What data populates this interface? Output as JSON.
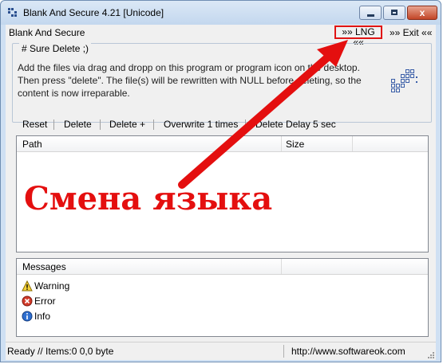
{
  "window": {
    "title": "Blank And Secure 4.21 [Unicode]",
    "close_glyph": "x"
  },
  "menu": {
    "app_label": "Blank And Secure",
    "lng_label": "»» LNG ««",
    "exit_label": "»» Exit ««"
  },
  "info": {
    "title": "# Sure Delete ;)",
    "text": "Add the files via drag and dropp on this program or program icon on the desktop. Then press \"delete\". The file(s) will be rewritten with NULL before deleting, so the content is now irreparable."
  },
  "toolbar": {
    "reset": "Reset",
    "delete": "Delete",
    "delete_plus": "Delete +",
    "overwrite": "Overwrite 1 times",
    "delete_delay": "Delete Delay 5 sec"
  },
  "file_list": {
    "columns": [
      "Path",
      "Size"
    ]
  },
  "messages": {
    "header": "Messages",
    "items": [
      {
        "label": "Warning",
        "icon": "warning-icon"
      },
      {
        "label": "Error",
        "icon": "error-icon"
      },
      {
        "label": "Info",
        "icon": "info-icon"
      }
    ]
  },
  "status": {
    "left": "Ready // Items:0 0,0 byte",
    "right": "http://www.softwareok.com"
  },
  "annotation": {
    "text": "Смена языка"
  },
  "colors": {
    "annotation_red": "#e40f0f",
    "title_bar": "#c3d7ee",
    "window_bg": "#f0f0f0"
  }
}
